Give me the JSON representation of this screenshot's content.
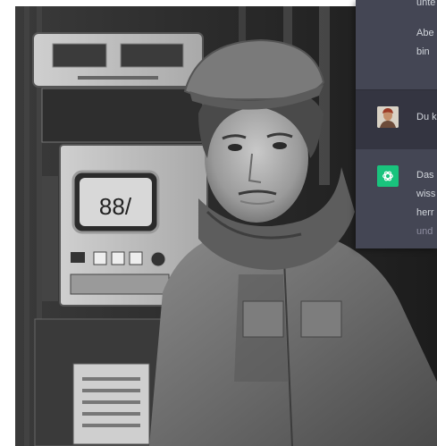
{
  "photo": {
    "machine_display": "88/"
  },
  "chat": {
    "assistant_top": {
      "line1": "unte",
      "line2": "Abe",
      "line3": "bin"
    },
    "user": {
      "text": "Du k"
    },
    "assistant_bottom": {
      "line1": "Das",
      "line2": "wiss",
      "line3": "herr",
      "line4": "und"
    }
  },
  "colors": {
    "panel_bg": "#343541",
    "assistant_bg": "#444654",
    "gpt_green": "#19c37d"
  }
}
